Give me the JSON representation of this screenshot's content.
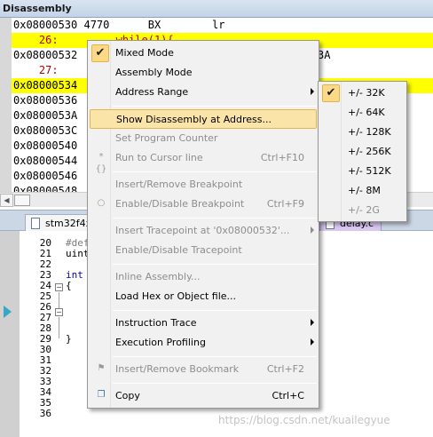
{
  "disassembly": {
    "title": "Disassembly",
    "lines": [
      {
        "text": "0x08000530 4770      BX        lr",
        "kind": "asm",
        "highlight": false
      },
      {
        "text": "    26:         while(1){",
        "kind": "src",
        "highlight": true
      },
      {
        "text": "0x08000532 ",
        "kind": "asm",
        "highlight": false
      },
      {
        "text": "    27: ",
        "kind": "src",
        "highlight": false
      },
      {
        "text": "0x08000534 ",
        "kind": "asm",
        "highlight": true
      },
      {
        "text": "0x08000536 ",
        "kind": "asm",
        "highlight": false
      },
      {
        "text": "0x0800053A ",
        "kind": "asm",
        "highlight": false
      },
      {
        "text": "0x0800053C ",
        "kind": "asm",
        "highlight": false
      },
      {
        "text": "0x08000540 ",
        "kind": "asm",
        "highlight": false
      },
      {
        "text": "0x08000544 ",
        "kind": "asm",
        "highlight": false
      },
      {
        "text": "0x08000546 ",
        "kind": "asm",
        "highlight": false
      },
      {
        "text": "0x08000548 ",
        "kind": "asm",
        "highlight": false
      }
    ],
    "partial_right": "3A"
  },
  "tabs": [
    {
      "label": "stm32f4xx",
      "active": false
    },
    {
      "label": "delay.c",
      "active": false
    }
  ],
  "editor": {
    "line_numbers": [
      "20",
      "21",
      "22",
      "23",
      "24",
      "25",
      "26",
      "27",
      "28",
      "29",
      "30",
      "31",
      "32",
      "33",
      "34",
      "35",
      "36"
    ],
    "code_lines": [
      "#def",
      "uint",
      "",
      "int",
      "{",
      "",
      "",
      "",
      "",
      "}",
      "",
      "",
      "",
      "",
      "",
      "",
      ""
    ],
    "pc_line": "26"
  },
  "context_menu": {
    "items": [
      {
        "type": "item",
        "label": "Mixed Mode",
        "checked": true,
        "enabled": true
      },
      {
        "type": "item",
        "label": "Assembly Mode",
        "enabled": true
      },
      {
        "type": "item",
        "label": "Address Range",
        "enabled": true,
        "submenu": true
      },
      {
        "type": "sep"
      },
      {
        "type": "item",
        "label": "Show Disassembly at Address...",
        "enabled": true,
        "hot": true
      },
      {
        "type": "item",
        "label": "Set Program Counter",
        "enabled": false
      },
      {
        "type": "item",
        "label": "Run to Cursor line",
        "shortcut": "Ctrl+F10",
        "enabled": false,
        "icon": "run-to-cursor-icon"
      },
      {
        "type": "sep"
      },
      {
        "type": "item",
        "label": "Insert/Remove Breakpoint",
        "enabled": false
      },
      {
        "type": "item",
        "label": "Enable/Disable Breakpoint",
        "shortcut": "Ctrl+F9",
        "enabled": false,
        "icon": "breakpoint-icon"
      },
      {
        "type": "sep"
      },
      {
        "type": "item",
        "label": "Insert Tracepoint at '0x08000532'...",
        "enabled": false,
        "submenu": true
      },
      {
        "type": "item",
        "label": "Enable/Disable Tracepoint",
        "enabled": false
      },
      {
        "type": "sep"
      },
      {
        "type": "item",
        "label": "Inline Assembly...",
        "enabled": false
      },
      {
        "type": "item",
        "label": "Load Hex or Object file...",
        "enabled": true
      },
      {
        "type": "sep"
      },
      {
        "type": "item",
        "label": "Instruction Trace",
        "enabled": true,
        "submenu": true
      },
      {
        "type": "item",
        "label": "Execution Profiling",
        "enabled": true,
        "submenu": true
      },
      {
        "type": "sep"
      },
      {
        "type": "item",
        "label": "Insert/Remove Bookmark",
        "shortcut": "Ctrl+F2",
        "enabled": false,
        "icon": "bookmark-icon"
      },
      {
        "type": "sep"
      },
      {
        "type": "item",
        "label": "Copy",
        "shortcut": "Ctrl+C",
        "enabled": true,
        "icon": "copy-icon"
      }
    ]
  },
  "address_range_submenu": {
    "items": [
      {
        "label": "+/- 32K",
        "checked": true,
        "enabled": true
      },
      {
        "label": "+/- 64K",
        "enabled": true
      },
      {
        "label": "+/- 128K",
        "enabled": true
      },
      {
        "label": "+/- 256K",
        "enabled": true
      },
      {
        "label": "+/- 512K",
        "enabled": true
      },
      {
        "label": "+/- 8M",
        "enabled": true
      },
      {
        "label": "+/- 2G",
        "enabled": false
      }
    ]
  },
  "watermark": "https://blog.csdn.net/kuailegyue",
  "colors": {
    "line_highlight": "#ffff00",
    "menu_hot": "#fbe4a8",
    "check_bg": "#fcd985",
    "pc_arrow": "#35a8c8"
  }
}
